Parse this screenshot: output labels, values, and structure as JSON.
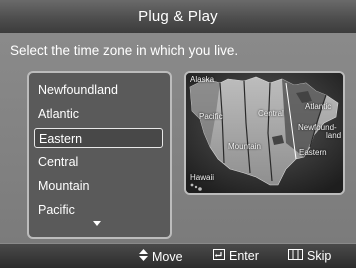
{
  "title": "Plug & Play",
  "instruction": "Select the time zone in which you live.",
  "time_zones": {
    "items": [
      "Newfoundland",
      "Atlantic",
      "Eastern",
      "Central",
      "Mountain",
      "Pacific"
    ],
    "selected": "Eastern"
  },
  "map": {
    "labels": {
      "alaska": "Alaska",
      "pacific": "Pacific",
      "central": "Central",
      "atlantic": "Atlantic",
      "newfoundland_1": "Newfound-",
      "newfoundland_2": "land",
      "mountain": "Mountain",
      "eastern": "Eastern",
      "hawaii": "Hawaii"
    }
  },
  "footer": {
    "move": "Move",
    "enter": "Enter",
    "skip": "Skip",
    "move_icon": "up-down-arrows-icon",
    "enter_icon": "enter-icon",
    "skip_icon": "skip-icon"
  }
}
